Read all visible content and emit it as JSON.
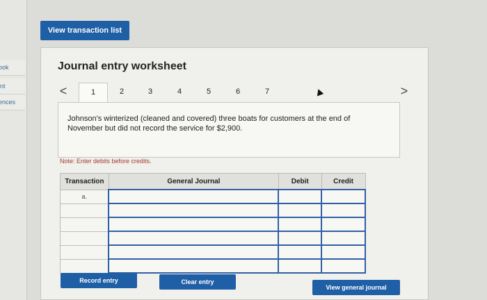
{
  "sidebar": {
    "items": [
      {
        "label": "ook"
      },
      {
        "label": "int"
      },
      {
        "label": "ences"
      }
    ]
  },
  "header": {
    "view_transactions_label": "View transaction list"
  },
  "worksheet": {
    "title": "Journal entry worksheet",
    "prev_arrow": "<",
    "next_arrow": ">",
    "tabs": [
      "1",
      "2",
      "3",
      "4",
      "5",
      "6",
      "7"
    ],
    "active_tab": "1",
    "description": "Johnson's winterized (cleaned and covered) three boats for customers at the end of November but did not record the service for $2,900.",
    "note": "Note: Enter debits before credits."
  },
  "table": {
    "headers": [
      "Transaction",
      "General Journal",
      "Debit",
      "Credit"
    ],
    "rows": [
      {
        "transaction": "a.",
        "journal": "",
        "debit": "",
        "credit": ""
      },
      {
        "transaction": "",
        "journal": "",
        "debit": "",
        "credit": ""
      },
      {
        "transaction": "",
        "journal": "",
        "debit": "",
        "credit": ""
      },
      {
        "transaction": "",
        "journal": "",
        "debit": "",
        "credit": ""
      },
      {
        "transaction": "",
        "journal": "",
        "debit": "",
        "credit": ""
      },
      {
        "transaction": "",
        "journal": "",
        "debit": "",
        "credit": ""
      }
    ]
  },
  "buttons": {
    "record": "Record entry",
    "clear": "Clear entry",
    "view_general": "View general journal"
  },
  "colors": {
    "accent": "#1f5fa6",
    "note": "#a33b2c"
  }
}
